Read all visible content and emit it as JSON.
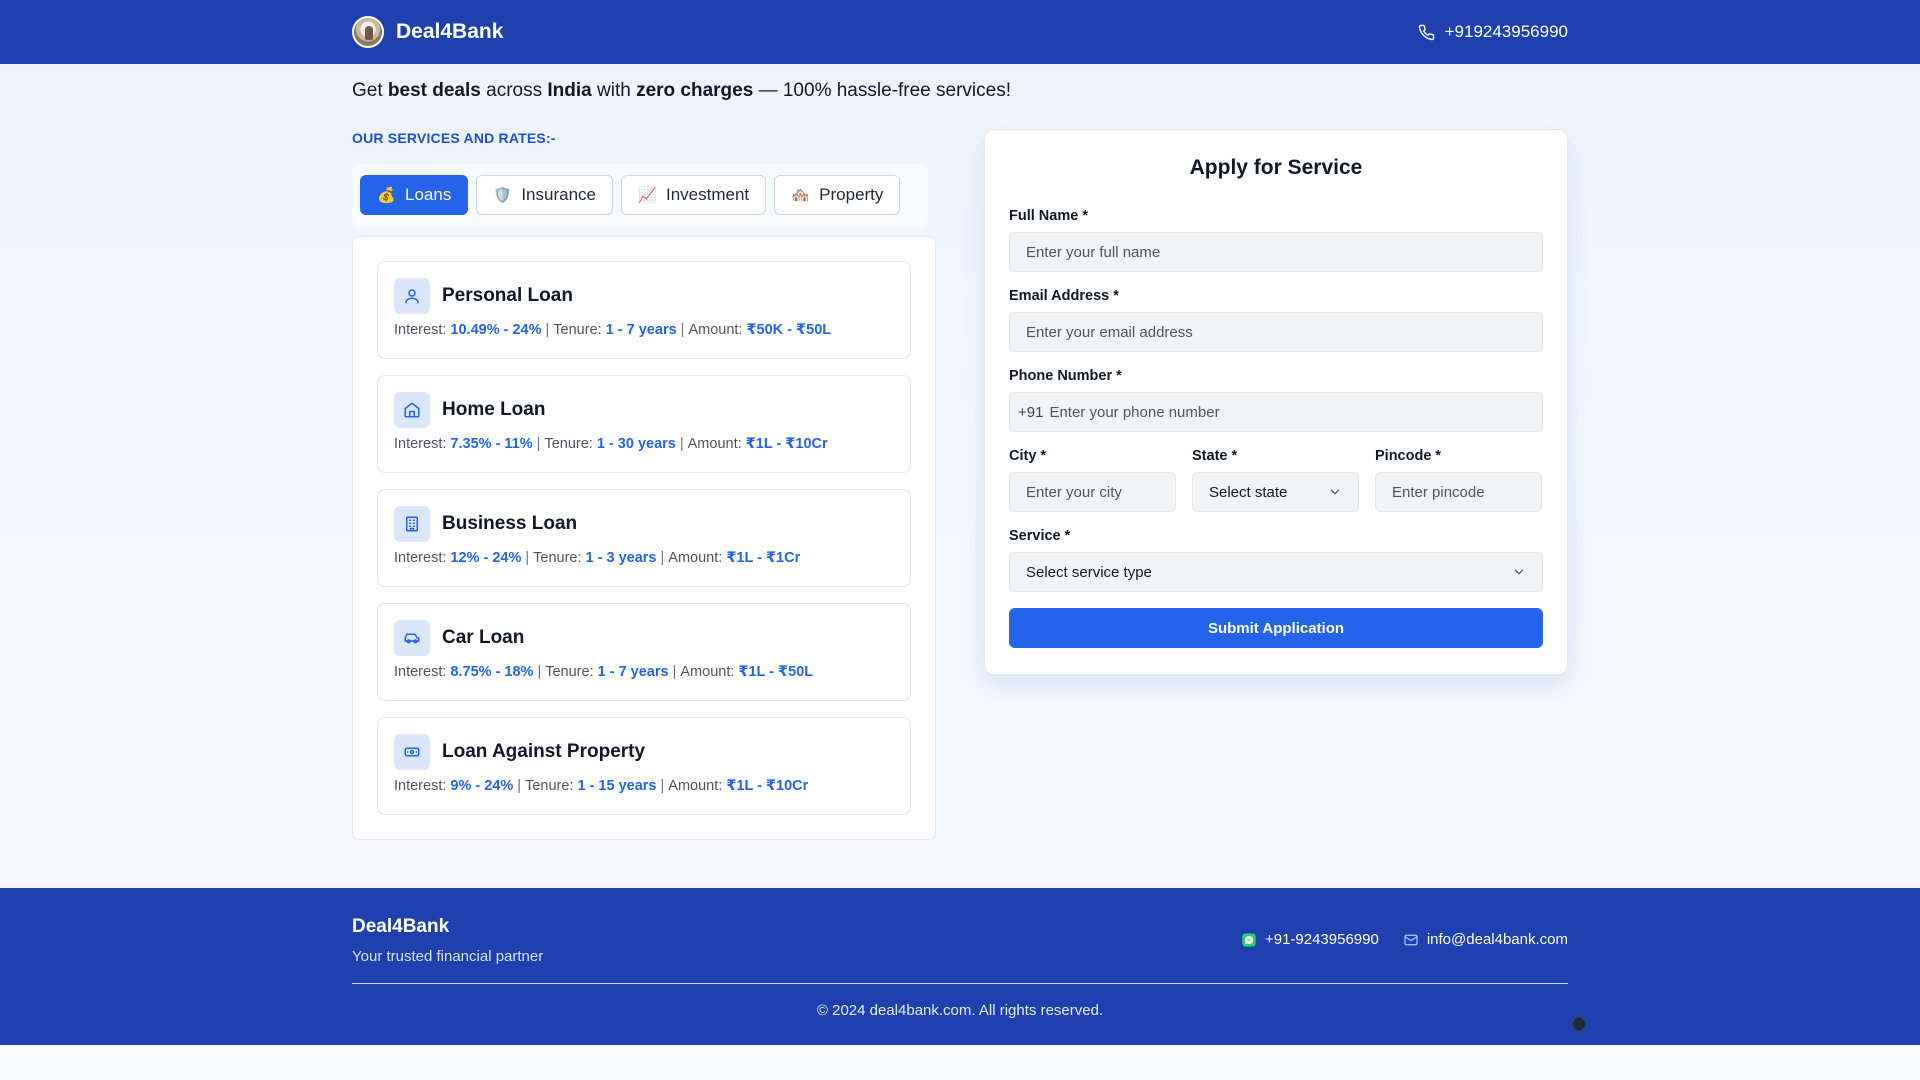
{
  "header": {
    "brand": "Deal4Bank",
    "phone": "+919243956990"
  },
  "tagline": {
    "p1": "Get ",
    "b1": "best deals",
    "p2": " across ",
    "b2": "India",
    "p3": " with ",
    "b3": "zero charges",
    "p4": " — 100% hassle-free services!"
  },
  "services_heading": "OUR SERVICES AND RATES:-",
  "tabs": [
    {
      "label": "Loans",
      "emoji": "💰"
    },
    {
      "label": "Insurance",
      "emoji": "🛡️"
    },
    {
      "label": "Investment",
      "emoji": "📈"
    },
    {
      "label": "Property",
      "emoji": "🏘️"
    }
  ],
  "meta_labels": {
    "interest": "Interest:",
    "tenure": "Tenure:",
    "amount": "Amount:",
    "sep": "|"
  },
  "services": [
    {
      "title": "Personal Loan",
      "interest": "10.49% - 24%",
      "tenure": "1 - 7 years",
      "amount": "₹50K - ₹50L",
      "icon": "user-icon"
    },
    {
      "title": "Home Loan",
      "interest": "7.35% - 11%",
      "tenure": "1 - 30 years",
      "amount": "₹1L - ₹10Cr",
      "icon": "home-icon"
    },
    {
      "title": "Business Loan",
      "interest": "12% - 24%",
      "tenure": "1 - 3 years",
      "amount": "₹1L - ₹1Cr",
      "icon": "building-icon"
    },
    {
      "title": "Car Loan",
      "interest": "8.75% - 18%",
      "tenure": "1 - 7 years",
      "amount": "₹1L - ₹50L",
      "icon": "car-icon"
    },
    {
      "title": "Loan Against Property",
      "interest": "9% - 24%",
      "tenure": "1 - 15 years",
      "amount": "₹1L - ₹10Cr",
      "icon": "banknote-icon"
    }
  ],
  "form": {
    "title": "Apply for Service",
    "full_name_label": "Full Name *",
    "full_name_placeholder": "Enter your full name",
    "email_label": "Email Address *",
    "email_placeholder": "Enter your email address",
    "phone_label": "Phone Number *",
    "phone_prefix": "+91",
    "phone_placeholder": "Enter your phone number",
    "city_label": "City *",
    "city_placeholder": "Enter your city",
    "state_label": "State *",
    "state_value": "Select state",
    "pincode_label": "Pincode *",
    "pincode_placeholder": "Enter pincode",
    "service_label": "Service *",
    "service_value": "Select service type",
    "submit_label": "Submit Application"
  },
  "footer": {
    "brand": "Deal4Bank",
    "tagline": "Your trusted financial partner",
    "whatsapp": "+91-9243956990",
    "email": "info@deal4bank.com",
    "copyright": "© 2024 deal4bank.com. All rights reserved."
  },
  "colors": {
    "primary": "#1e40af",
    "accent": "#2563eb",
    "whatsapp": "#25d366"
  }
}
